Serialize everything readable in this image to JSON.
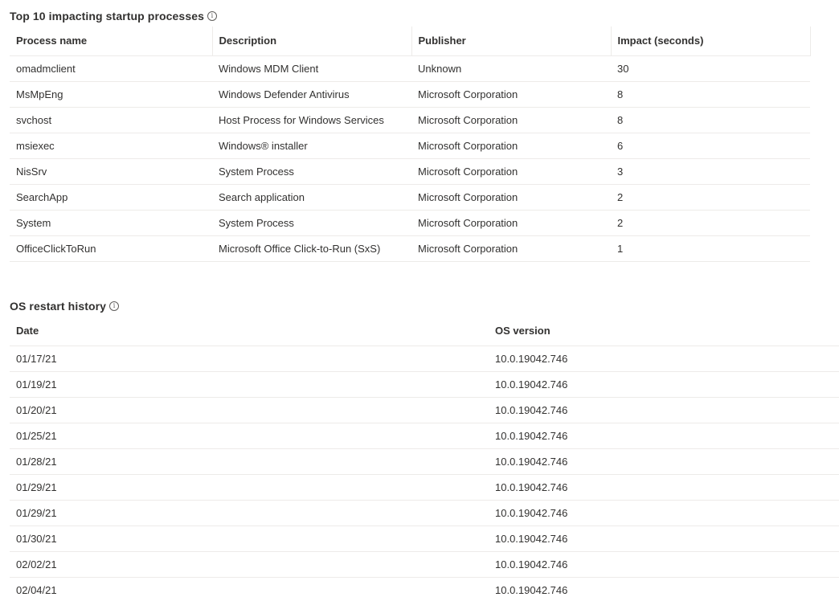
{
  "processes": {
    "title": "Top 10 impacting startup processes",
    "info_glyph": "i",
    "headers": [
      "Process name",
      "Description",
      "Publisher",
      "Impact (seconds)"
    ],
    "rows": [
      [
        "omadmclient",
        "Windows MDM Client",
        "Unknown",
        "30"
      ],
      [
        "MsMpEng",
        "Windows Defender Antivirus",
        "Microsoft Corporation",
        "8"
      ],
      [
        "svchost",
        "Host Process for Windows Services",
        "Microsoft Corporation",
        "8"
      ],
      [
        "msiexec",
        "Windows® installer",
        "Microsoft Corporation",
        "6"
      ],
      [
        "NisSrv",
        "System Process",
        "Microsoft Corporation",
        "3"
      ],
      [
        "SearchApp",
        "Search application",
        "Microsoft Corporation",
        "2"
      ],
      [
        "System",
        "System Process",
        "Microsoft Corporation",
        "2"
      ],
      [
        "OfficeClickToRun",
        "Microsoft Office Click-to-Run (SxS)",
        "Microsoft Corporation",
        "1"
      ]
    ]
  },
  "restarts": {
    "title": "OS restart history",
    "info_glyph": "i",
    "headers": [
      "Date",
      "OS version"
    ],
    "rows": [
      [
        "01/17/21",
        "10.0.19042.746"
      ],
      [
        "01/19/21",
        "10.0.19042.746"
      ],
      [
        "01/20/21",
        "10.0.19042.746"
      ],
      [
        "01/25/21",
        "10.0.19042.746"
      ],
      [
        "01/28/21",
        "10.0.19042.746"
      ],
      [
        "01/29/21",
        "10.0.19042.746"
      ],
      [
        "01/29/21",
        "10.0.19042.746"
      ],
      [
        "01/30/21",
        "10.0.19042.746"
      ],
      [
        "02/02/21",
        "10.0.19042.746"
      ],
      [
        "02/04/21",
        "10.0.19042.746"
      ]
    ]
  },
  "icons": {
    "info": "info-icon"
  },
  "colors": {
    "text": "#323130",
    "divider": "#edebe9",
    "icon": "#605e5c"
  }
}
